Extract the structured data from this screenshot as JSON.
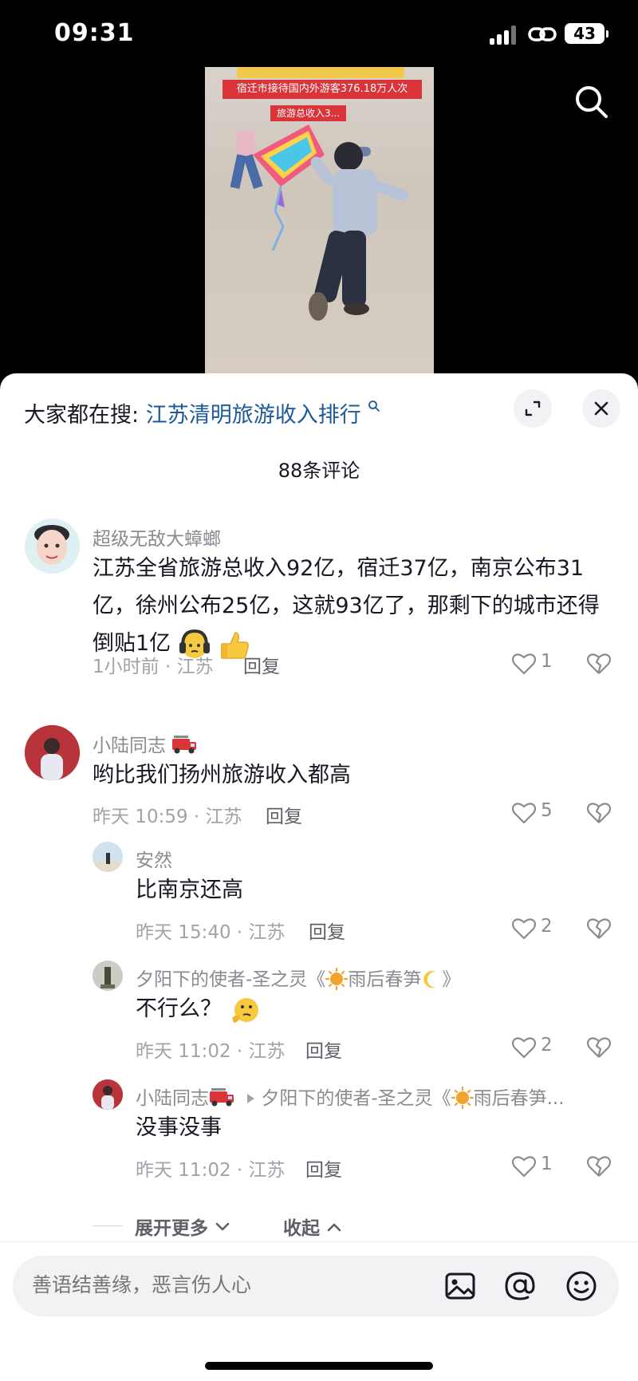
{
  "status_bar": {
    "time": "09:31",
    "battery": "43"
  },
  "video": {
    "banner_text": "宿迁市接待国内外游客376.18万人次",
    "sub_banner_text": "旅游总收入3..."
  },
  "sheet": {
    "hot_search_prefix": "大家都在搜:",
    "hot_search_keyword": "江苏清明旅游收入排行",
    "comment_count": "88条评论"
  },
  "comments": [
    {
      "username": "超级无敌大蟑螂",
      "content": "江苏全省旅游总收入92亿，宿迁37亿，南京公布31亿，徐州公布25亿，这就93亿了，那剩下的城市还得倒贴1亿",
      "time_location": "1小时前 · 江苏",
      "reply_label": "回复",
      "likes": "1"
    },
    {
      "username": "小陆同志",
      "content": "哟比我们扬州旅游收入都高",
      "time_location": "昨天 10:59 · 江苏",
      "reply_label": "回复",
      "likes": "5"
    }
  ],
  "replies": [
    {
      "username": "安然",
      "content": "比南京还高",
      "time_location": "昨天 15:40 · 江苏",
      "reply_label": "回复",
      "likes": "2"
    },
    {
      "username_part1": "夕阳下的使者-圣之灵《",
      "username_part2": "雨后春笋",
      "username_part3": "》",
      "content": "不行么？",
      "time_location": "昨天 11:02 · 江苏",
      "reply_label": "回复",
      "likes": "2"
    },
    {
      "username": "小陆同志",
      "reply_to_part1": "夕阳下的使者-圣之灵《",
      "reply_to_part2": "雨后春笋...",
      "content": "没事没事",
      "time_location": "昨天 11:02 · 江苏",
      "reply_label": "回复",
      "likes": "1"
    }
  ],
  "thread_controls": {
    "expand_more": "展开更多",
    "collapse": "收起"
  },
  "input": {
    "placeholder": "善语结善缘，恶言伤人心"
  },
  "colors": {
    "accent_link": "#1c5a9c",
    "secondary_text": "#8a8b91",
    "background_top": "#000000"
  },
  "icons": [
    "search-icon",
    "expand-icon",
    "close-icon",
    "heart-icon",
    "broken-heart-icon",
    "image-icon",
    "at-icon",
    "emoji-icon",
    "fire-truck-emoji",
    "sun-emoji",
    "moon-emoji",
    "thumbs-up-emoji",
    "thinking-emoji",
    "headphones-emoji"
  ]
}
